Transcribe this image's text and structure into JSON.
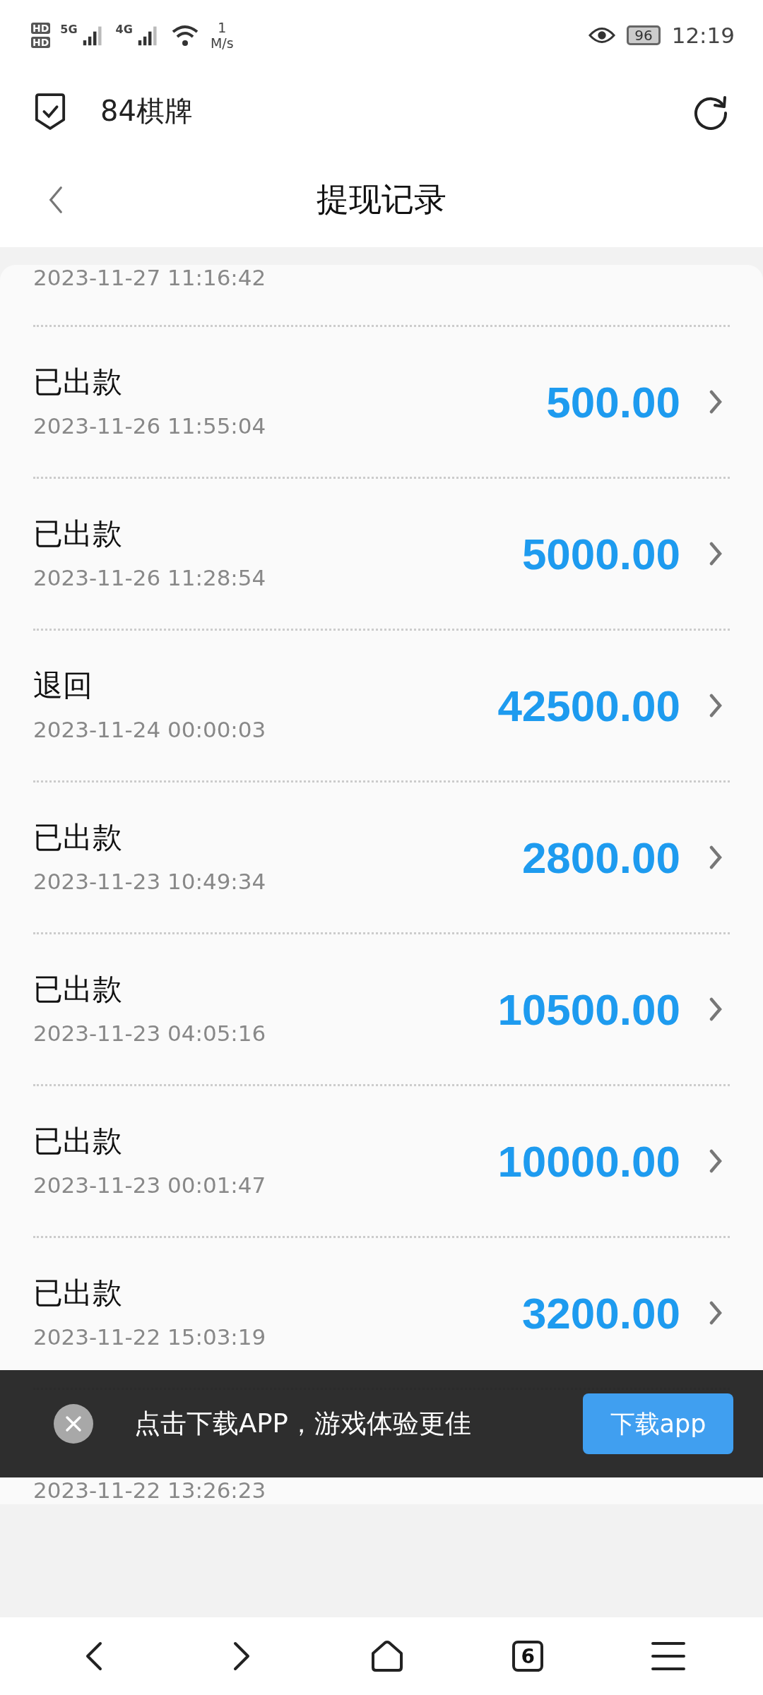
{
  "status_bar": {
    "hd_labels": [
      "HD",
      "HD"
    ],
    "networks": [
      "5G",
      "4G"
    ],
    "speed_value": "1",
    "speed_unit": "M/s",
    "battery": "96",
    "time": "12:19"
  },
  "browser_bar": {
    "site_title": "84棋牌"
  },
  "header": {
    "title": "提现记录"
  },
  "records": [
    {
      "kind": "partial",
      "date": "2023-11-27 11:16:42"
    },
    {
      "kind": "full",
      "status": "已出款",
      "date": "2023-11-26 11:55:04",
      "amount": "500.00"
    },
    {
      "kind": "full",
      "status": "已出款",
      "date": "2023-11-26 11:28:54",
      "amount": "5000.00"
    },
    {
      "kind": "full",
      "status": "退回",
      "date": "2023-11-24 00:00:03",
      "amount": "42500.00"
    },
    {
      "kind": "full",
      "status": "已出款",
      "date": "2023-11-23 10:49:34",
      "amount": "2800.00"
    },
    {
      "kind": "full",
      "status": "已出款",
      "date": "2023-11-23 04:05:16",
      "amount": "10500.00"
    },
    {
      "kind": "full",
      "status": "已出款",
      "date": "2023-11-23 00:01:47",
      "amount": "10000.00"
    },
    {
      "kind": "full",
      "status": "已出款",
      "date": "2023-11-22 15:03:19",
      "amount": "3200.00"
    },
    {
      "kind": "covered",
      "date": "2023-11-22 13:26:23"
    }
  ],
  "download_banner": {
    "message": "点击下载APP，游戏体验更佳",
    "button": "下载app"
  },
  "bottom_nav": {
    "tab_count": "6"
  }
}
